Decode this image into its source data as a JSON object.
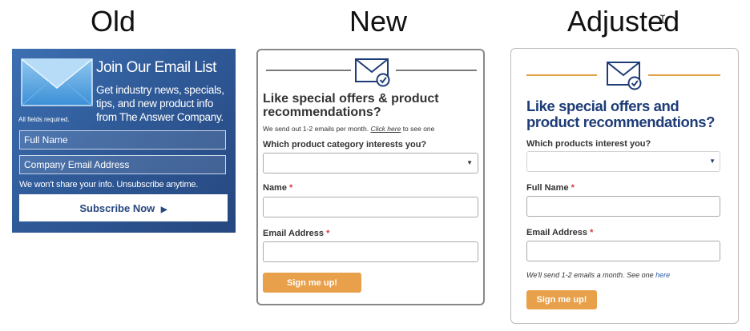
{
  "titles": {
    "old": "Old",
    "new": "New",
    "adjusted": "Adjusted"
  },
  "old": {
    "heading": "Join Our Email List",
    "description": "Get industry news, specials, tips, and new product info from The Answer Company.",
    "required_note": "All fields required.",
    "full_name_placeholder": "Full Name",
    "email_placeholder": "Company Email Address",
    "privacy": "We won't share your info. Unsubscribe anytime.",
    "subscribe_label": "Subscribe Now",
    "subscribe_arrow": "▶"
  },
  "new": {
    "heading": "Like special offers & product recommendations?",
    "note_prefix": "We send out 1-2 emails per month.",
    "note_link": "Click here",
    "note_suffix": "to see one",
    "category_label": "Which product category interests you?",
    "category_caret": "▼",
    "name_label": "Name",
    "email_label": "Email Address",
    "required_star": "*",
    "button_label": "Sign me up!"
  },
  "adjusted": {
    "heading": "Like special offers and product recommendations?",
    "products_label": "Which products interest you?",
    "products_caret": "▼",
    "full_name_label": "Full Name",
    "email_label": "Email Address",
    "required_star": "*",
    "note_prefix": "We'll send 1-2 emails a month. See one",
    "note_link": "here",
    "button_label": "Sign me up!"
  },
  "icons": {
    "envelope": "envelope-check-icon",
    "mail_large": "mail-icon"
  },
  "colors": {
    "old_bg": "#2f5a98",
    "old_text": "#ffffff",
    "old_button_text": "#26477f",
    "new_border": "#888888",
    "accent_orange": "#e8a04a",
    "adjusted_heading": "#1e3c77",
    "required": "#d9363e",
    "link": "#2a5aa5"
  }
}
